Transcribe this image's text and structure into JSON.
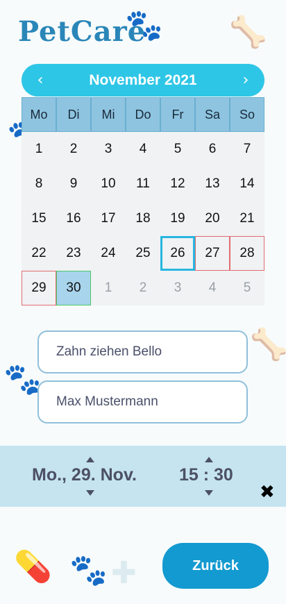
{
  "app": {
    "logo_text": "PetCare"
  },
  "calendar": {
    "month_label": "November 2021",
    "prev_icon": "‹",
    "next_icon": "›",
    "weekdays": [
      "Mo",
      "Di",
      "Mi",
      "Do",
      "Fr",
      "Sa",
      "So"
    ],
    "days": [
      "1",
      "2",
      "3",
      "4",
      "5",
      "6",
      "7",
      "8",
      "9",
      "10",
      "11",
      "12",
      "13",
      "14",
      "15",
      "16",
      "17",
      "18",
      "19",
      "20",
      "21",
      "22",
      "23",
      "24",
      "25",
      "26",
      "27",
      "28",
      "29",
      "30",
      "1",
      "2",
      "3",
      "4",
      "5"
    ],
    "today_day": "26",
    "booked_days": [
      "27",
      "28",
      "29"
    ],
    "selected_day": "30"
  },
  "form": {
    "appointment_value": "Zahn ziehen Bello",
    "owner_value": "Max Mustermann"
  },
  "picker": {
    "date_display": "Mo., 29. Nov.",
    "time_display": "15 : 30",
    "close_icon": "✖"
  },
  "actions": {
    "back_label": "Zurück"
  },
  "colors": {
    "accent": "#2ec6e6",
    "button": "#139ad0",
    "band": "#c5e4f0",
    "weekday_bg": "#8ec4e0"
  }
}
